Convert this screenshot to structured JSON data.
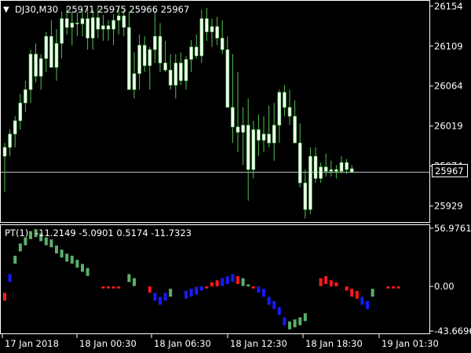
{
  "header": {
    "symbol": "DJ30,M30",
    "ohlc": "25971 25975 25966 25967"
  },
  "indicator": {
    "label": "PT(1)",
    "values_text": "-11.2149 -5.0901 0.5174 -11.7323"
  },
  "colors": {
    "background": "#000000",
    "bull_candle": "#f0fff0",
    "wick": "#4fc24f",
    "grid": "#ffffff",
    "hist_green": "#5ab06a",
    "hist_red": "#ff1a1a",
    "hist_blue": "#1a1aff"
  },
  "chart_data": [
    {
      "type": "candlestick",
      "title": "DJ30,M30",
      "current_price": 25967,
      "current_price_label": "25967",
      "yticks": [
        "26154",
        "26109",
        "26064",
        "26019",
        "25974",
        "25929"
      ],
      "ytick_values": [
        26154,
        26109,
        26064,
        26019,
        25974,
        25929
      ],
      "ylim": [
        25911,
        26160
      ],
      "xticks": [
        "17 Jan 2018",
        "18 Jan 00:30",
        "18 Jan 06:30",
        "18 Jan 12:30",
        "18 Jan 18:30",
        "19 Jan 01:30"
      ],
      "candles": [
        [
          25985,
          26000,
          25945,
          25995
        ],
        [
          25995,
          26015,
          25985,
          26010
        ],
        [
          26010,
          26030,
          25995,
          26025
        ],
        [
          26025,
          26055,
          26015,
          26045
        ],
        [
          26045,
          26070,
          26035,
          26060
        ],
        [
          26060,
          26105,
          26045,
          26100
        ],
        [
          26100,
          26112,
          26068,
          26075
        ],
        [
          26075,
          26100,
          26060,
          26095
        ],
        [
          26095,
          26125,
          26080,
          26120
        ],
        [
          26120,
          26138,
          26092,
          26085
        ],
        [
          26085,
          26128,
          26070,
          26112
        ],
        [
          26112,
          26148,
          26095,
          26140
        ],
        [
          26140,
          26154,
          26122,
          26130
        ],
        [
          26130,
          26148,
          26110,
          26135
        ],
        [
          26135,
          26147,
          26120,
          26134
        ],
        [
          26134,
          26150,
          26120,
          26140
        ],
        [
          26140,
          26152,
          26105,
          26118
        ],
        [
          26118,
          26150,
          26105,
          26141
        ],
        [
          26141,
          26155,
          26118,
          26128
        ],
        [
          26128,
          26144,
          26115,
          26132
        ],
        [
          26132,
          26138,
          26115,
          26128
        ],
        [
          26128,
          26145,
          26110,
          26138
        ],
        [
          26138,
          26152,
          26122,
          26143
        ],
        [
          26143,
          26150,
          26120,
          26130
        ],
        [
          26130,
          26148,
          26080,
          26060
        ],
        [
          26060,
          26102,
          26050,
          26078
        ],
        [
          26078,
          26122,
          26060,
          26110
        ],
        [
          26110,
          26120,
          26080,
          26087
        ],
        [
          26087,
          26108,
          26060,
          26105
        ],
        [
          26105,
          26148,
          26090,
          26120
        ],
        [
          26120,
          26135,
          26080,
          26090
        ],
        [
          26090,
          26115,
          26080,
          26082
        ],
        [
          26082,
          26100,
          26060,
          26065
        ],
        [
          26065,
          26100,
          26050,
          26090
        ],
        [
          26090,
          26102,
          26065,
          26070
        ],
        [
          26070,
          26098,
          26060,
          26094
        ],
        [
          26094,
          26116,
          26080,
          26108
        ],
        [
          26108,
          26122,
          26095,
          26098
        ],
        [
          26098,
          26150,
          26090,
          26140
        ],
        [
          26140,
          26152,
          26115,
          26125
        ],
        [
          26125,
          26140,
          26108,
          26131
        ],
        [
          26131,
          26142,
          26110,
          26118
        ],
        [
          26118,
          26138,
          26100,
          26105
        ],
        [
          26105,
          26120,
          26050,
          26040
        ],
        [
          26040,
          26100,
          26000,
          26018
        ],
        [
          26018,
          26080,
          25990,
          26012
        ],
        [
          26012,
          26040,
          25975,
          26020
        ],
        [
          26020,
          26050,
          25935,
          25970
        ],
        [
          25970,
          26025,
          25960,
          26015
        ],
        [
          26015,
          26032,
          25985,
          26003
        ],
        [
          26003,
          26030,
          25990,
          26010
        ],
        [
          26010,
          26042,
          25995,
          26000
        ],
        [
          26000,
          26045,
          25980,
          26020
        ],
        [
          26020,
          26060,
          26000,
          26057
        ],
        [
          26057,
          26065,
          26030,
          26040
        ],
        [
          26040,
          26060,
          26020,
          26030
        ],
        [
          26030,
          26048,
          26005,
          26000
        ],
        [
          26000,
          26022,
          25950,
          25955
        ],
        [
          25955,
          25970,
          25915,
          25925
        ],
        [
          25925,
          25995,
          25920,
          25985
        ],
        [
          25985,
          25995,
          25955,
          25960
        ],
        [
          25960,
          25978,
          25955,
          25973
        ],
        [
          25973,
          25988,
          25962,
          25968
        ],
        [
          25968,
          25980,
          25962,
          25970
        ],
        [
          25970,
          25975,
          25960,
          25968
        ],
        [
          25968,
          25985,
          25966,
          25978
        ],
        [
          25978,
          25982,
          25965,
          25970
        ],
        [
          25971,
          25975,
          25966,
          25967
        ]
      ]
    },
    {
      "type": "histogram",
      "title": "PT(1)",
      "yticks": [
        "56.9761",
        "0.00",
        "-43.6696"
      ],
      "ytick_values": [
        56.9761,
        0,
        -43.6696
      ],
      "ylim": [
        -46,
        60
      ],
      "values": [
        -14,
        12,
        30,
        42,
        48,
        54,
        56,
        52,
        48,
        46,
        40,
        36,
        32,
        30,
        26,
        22,
        18,
        0,
        0,
        -2,
        -2,
        -2,
        -2,
        0,
        12,
        8,
        0,
        0,
        -6,
        -14,
        -18,
        -14,
        -10,
        0,
        0,
        -12,
        -10,
        -8,
        -4,
        -2,
        4,
        6,
        8,
        10,
        12,
        10,
        8,
        2,
        -2,
        -6,
        -10,
        -18,
        -22,
        -28,
        -38,
        -42,
        -40,
        -38,
        -34,
        0,
        0,
        8,
        10,
        6,
        4,
        0,
        -4,
        -10,
        -12,
        -18,
        -22,
        -10,
        0,
        0,
        -2,
        -2,
        -2
      ],
      "colors": [
        "r",
        "b",
        "g",
        "g",
        "g",
        "g",
        "g",
        "g",
        "g",
        "g",
        "g",
        "g",
        "g",
        "g",
        "g",
        "g",
        "g",
        "",
        "",
        "r",
        "r",
        "r",
        "r",
        "",
        "g",
        "g",
        "",
        "",
        "r",
        "b",
        "b",
        "b",
        "g",
        "",
        "",
        "b",
        "b",
        "b",
        "b",
        "r",
        "r",
        "r",
        "b",
        "b",
        "b",
        "r",
        "g",
        "g",
        "r",
        "b",
        "b",
        "b",
        "b",
        "b",
        "b",
        "g",
        "g",
        "g",
        "g",
        "",
        "",
        "r",
        "r",
        "r",
        "r",
        "",
        "r",
        "r",
        "r",
        "b",
        "b",
        "g",
        "",
        "",
        "r",
        "r",
        "r"
      ]
    }
  ]
}
